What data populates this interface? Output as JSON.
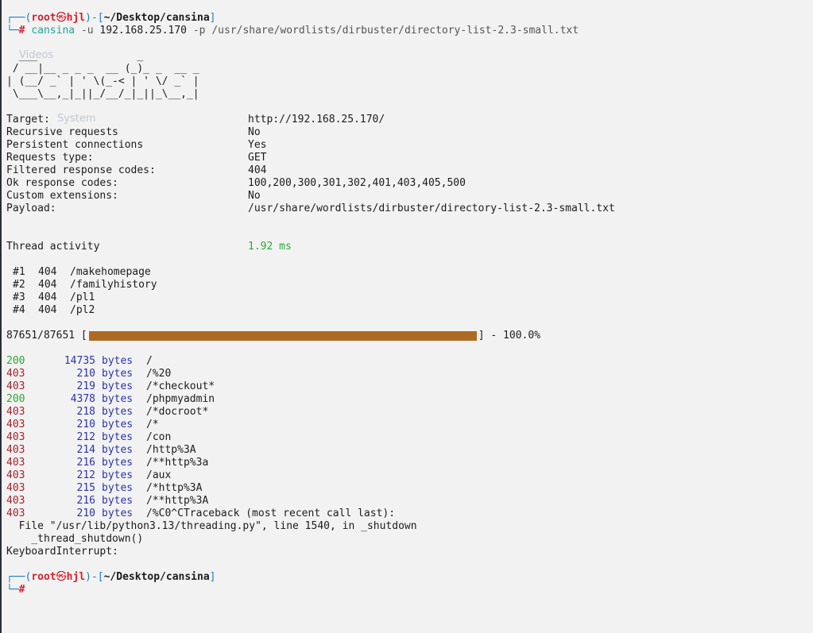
{
  "prompt": {
    "frame_open": "┌──(",
    "user": "root",
    "at_icon": "㉿",
    "host": "hjl",
    "mid": ")-[",
    "path": "~/Desktop/cansina",
    "close": "]",
    "frame_close": "└─",
    "hash": "#"
  },
  "command": {
    "program": "cansina",
    "flag_u": "-u",
    "url": "192.168.25.170",
    "flag_p": "-p",
    "wordlist": "/usr/share/wordlists/dirbuster/directory-list-2.3-small.txt"
  },
  "banner": [
    "  ___                _",
    " / __|__ _ _ _  __ (_)_ _  __ _",
    "| (__/ _` | ' \\(_-< | ' \\/ _` |",
    " \\___\\__,_|_||_/__/_|_||_\\__,_|"
  ],
  "config": [
    {
      "key": "Target:",
      "value": "http://192.168.25.170/"
    },
    {
      "key": "Recursive requests",
      "value": "No"
    },
    {
      "key": "Persistent connections",
      "value": "Yes"
    },
    {
      "key": "Requests type:",
      "value": "GET"
    },
    {
      "key": "Filtered response codes:",
      "value": "404"
    },
    {
      "key": "Ok response codes:",
      "value": "100,200,300,301,302,401,403,405,500"
    },
    {
      "key": "Custom extensions:",
      "value": "No"
    },
    {
      "key": "Payload:",
      "value": "/usr/share/wordlists/dirbuster/directory-list-2.3-small.txt"
    }
  ],
  "thread_activity": {
    "label": "Thread activity",
    "value": "1.92 ms"
  },
  "threads": [
    {
      "num": "#1",
      "code": "404",
      "path": "/makehomepage"
    },
    {
      "num": "#2",
      "code": "404",
      "path": "/familyhistory"
    },
    {
      "num": "#3",
      "code": "404",
      "path": "/pl1"
    },
    {
      "num": "#4",
      "code": "404",
      "path": "/pl2"
    }
  ],
  "progress": {
    "count": "87651/87651",
    "open": "[",
    "close": "]",
    "percent_text": "- 100.0%",
    "fraction": 1.0
  },
  "results": [
    {
      "status": "200",
      "size": "14735",
      "unit": "bytes",
      "path": "/"
    },
    {
      "status": "403",
      "size": "210",
      "unit": "bytes",
      "path": "/%20"
    },
    {
      "status": "403",
      "size": "219",
      "unit": "bytes",
      "path": "/*checkout*"
    },
    {
      "status": "200",
      "size": "4378",
      "unit": "bytes",
      "path": "/phpmyadmin"
    },
    {
      "status": "403",
      "size": "218",
      "unit": "bytes",
      "path": "/*docroot*"
    },
    {
      "status": "403",
      "size": "210",
      "unit": "bytes",
      "path": "/*"
    },
    {
      "status": "403",
      "size": "212",
      "unit": "bytes",
      "path": "/con"
    },
    {
      "status": "403",
      "size": "214",
      "unit": "bytes",
      "path": "/http%3A"
    },
    {
      "status": "403",
      "size": "216",
      "unit": "bytes",
      "path": "/**http%3a"
    },
    {
      "status": "403",
      "size": "212",
      "unit": "bytes",
      "path": "/aux"
    },
    {
      "status": "403",
      "size": "215",
      "unit": "bytes",
      "path": "/*http%3A"
    },
    {
      "status": "403",
      "size": "216",
      "unit": "bytes",
      "path": "/**http%3A"
    },
    {
      "status": "403",
      "size": "210",
      "unit": "bytes",
      "path": "/%C0^CTraceback (most recent call last):"
    }
  ],
  "traceback": [
    "  File \"/usr/lib/python3.13/threading.py\", line 1540, in _shutdown",
    "    _thread_shutdown()",
    "KeyboardInterrupt:"
  ],
  "ghost_text": {
    "videos": "Videos",
    "system": "System"
  },
  "colors": {
    "ok": "#2ea836",
    "forbidden": "#a4232e",
    "bytes": "#2b34a8",
    "bar": "#ad6b21",
    "prompt_frame": "#1c7ec3",
    "prompt_user": "#d0232f"
  }
}
